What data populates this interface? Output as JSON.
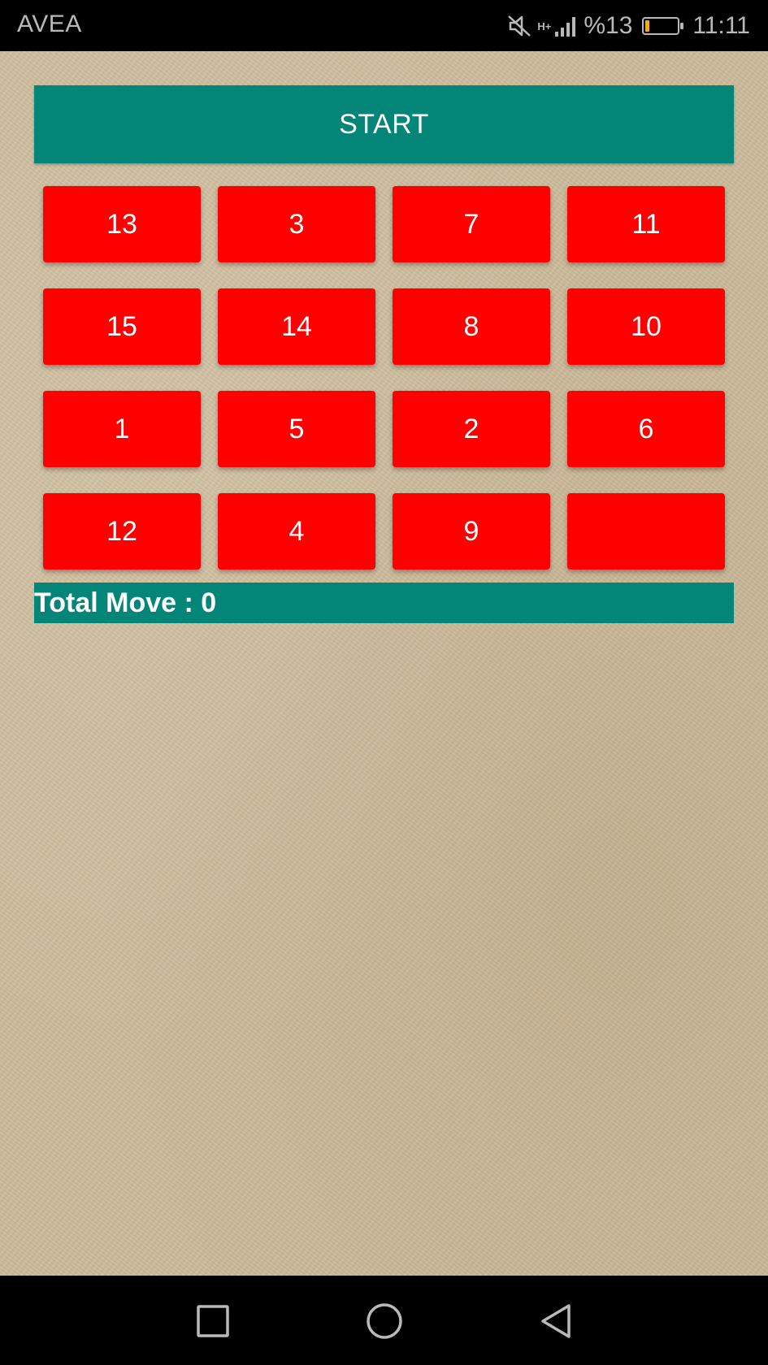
{
  "status_bar": {
    "carrier": "AVEA",
    "network_type": "H+",
    "battery_percent": "%13",
    "battery_level": 0.13,
    "battery_color": "#f5a623",
    "time": "11:11",
    "icons": [
      "mute-icon",
      "signal-icon",
      "battery-icon"
    ]
  },
  "app": {
    "start_label": "START",
    "tiles": [
      "13",
      "3",
      "7",
      "11",
      "15",
      "14",
      "8",
      "10",
      "1",
      "5",
      "2",
      "6",
      "12",
      "4",
      "9",
      ""
    ],
    "total_move_label": "Total Move : 0",
    "colors": {
      "accent": "#038578",
      "tile": "#ff0000",
      "background": "#cdbb9b"
    }
  },
  "nav_bar": {
    "icons": [
      "recents-square-icon",
      "home-circle-icon",
      "back-triangle-icon"
    ]
  }
}
